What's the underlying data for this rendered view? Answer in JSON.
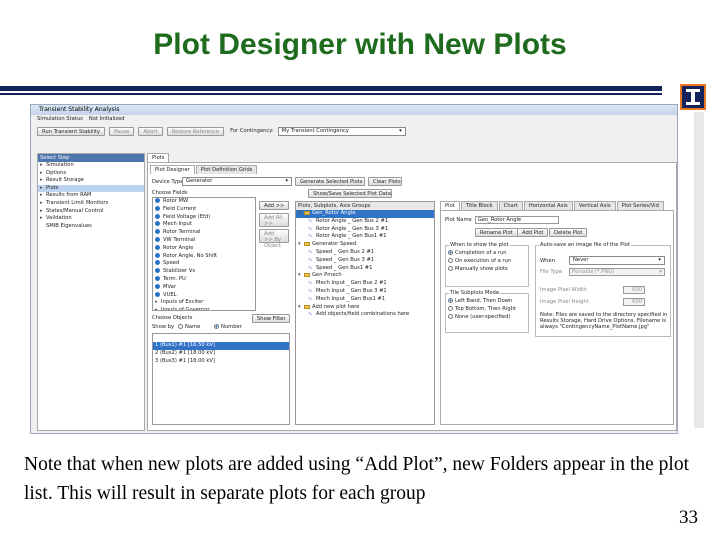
{
  "slide": {
    "title": "Plot Designer with New Plots",
    "caption": "Note that when new plots are added using “Add Plot”, new Folders appear in the plot list.  This will result in separate plots for each group",
    "page_number": "33"
  },
  "app": {
    "window_title": "Transient Stability Analysis",
    "status_label": "Simulation Status",
    "status_value": "Not Initialized",
    "toolbar": {
      "run": "Run Transient Stability",
      "pause": "Pause",
      "abort": "Abort",
      "restore": "Restore Reference",
      "contingency_label": "For Contingency:",
      "contingency_value": "My Transient Contingency"
    },
    "select_step": "Select Step",
    "steps": [
      {
        "label": "Simulation",
        "expandable": true
      },
      {
        "label": "Options",
        "expandable": true
      },
      {
        "label": "Result Storage",
        "expandable": true
      },
      {
        "label": "Plots",
        "expandable": true,
        "selected": true
      },
      {
        "label": "Results from RAM",
        "expandable": true
      },
      {
        "label": "Transient Limit Monitors",
        "expandable": true
      },
      {
        "label": "States/Manual Control",
        "expandable": true
      },
      {
        "label": "Validation",
        "expandable": true
      },
      {
        "label": "SMIB Eigenvalues",
        "expandable": false
      }
    ],
    "main_tabs": [
      "Plot Designer",
      "Plot Definition Grids"
    ],
    "main_tab_top": "Plots",
    "device_type_label": "Device Type",
    "device_type_value": "Generator",
    "choose_fields_label": "Choose Fields",
    "fields": [
      "Rotor MW",
      "Field Current",
      "Field Voltage (Efd)",
      "Mech Input",
      "Rotor Terminal",
      "VW Terminal",
      "Rotor Angle",
      "Rotor Angle, No Shift",
      "Speed",
      "Stabilizer Vs",
      "Term. PU",
      "MVar",
      "VUEL",
      "Inputs of Exciter",
      "Inputs of Governor"
    ],
    "add_btn": "Add >>",
    "add_all_btn": "Add All >>",
    "add_by_obj_btn": "Add >> By Object",
    "choose_objects_label": "Choose Objects",
    "show_by_label": "Show by",
    "show_by_options": [
      "Name",
      "Number"
    ],
    "show_filter_btn": "Show Filter",
    "objects": [
      "1 (Bus1) #1 [16.50 kV]",
      "2 (Bus2) #1 [18.00 kV]",
      "3 (Bus3) #1 [18.00 kV]"
    ],
    "generate_btn": "Generate Selected Plots",
    "clear_plots_btn": "Clear Plots",
    "show_save_btn": "Show/Save Selected Plot Data",
    "plots_header": "Plots, Subplots, Axis Groups",
    "plot_tree": [
      {
        "kind": "folder",
        "label": "Gen_Rotor Angle",
        "level": 0,
        "selected": true
      },
      {
        "kind": "item",
        "label": "Rotor Angle _ Gen Bus 2 #1",
        "level": 1
      },
      {
        "kind": "item",
        "label": "Rotor Angle _ Gen Bus 3 #1",
        "level": 1
      },
      {
        "kind": "item",
        "label": "Rotor Angle _ Gen Bus1 #1",
        "level": 1
      },
      {
        "kind": "folder",
        "label": "Generator Speed",
        "level": 0
      },
      {
        "kind": "item",
        "label": "Speed _ Gen Bus 2 #1",
        "level": 1
      },
      {
        "kind": "item",
        "label": "Speed _ Gen Bus 3 #1",
        "level": 1
      },
      {
        "kind": "item",
        "label": "Speed _ Gen Bus1 #1",
        "level": 1
      },
      {
        "kind": "folder",
        "label": "Gen Pmech",
        "level": 0
      },
      {
        "kind": "item",
        "label": "Mech Input _ Gen Bus 2 #1",
        "level": 1
      },
      {
        "kind": "item",
        "label": "Mech Input _ Gen Bus 3 #1",
        "level": 1
      },
      {
        "kind": "item",
        "label": "Mech Input _ Gen Bus1 #1",
        "level": 1
      },
      {
        "kind": "folder",
        "label": "Add new plot here",
        "level": 0
      },
      {
        "kind": "item",
        "label": "Add objects/field combinations here",
        "level": 1
      }
    ],
    "right_tabs": [
      "Plot",
      "Title Block",
      "Chart",
      "Horizontal Axis",
      "Vertical Axis",
      "Plot Series/Vid"
    ],
    "plot_name_label": "Plot Name",
    "plot_name_value": "Gen_Rotor Angle",
    "rename_btn": "Rename Plot",
    "add_plot_btn": "Add Plot",
    "delete_plot_btn": "Delete Plot",
    "when_show_label": "When to show the plot",
    "when_show_options": [
      "Completion of a run",
      "On execution of a run",
      "Manually show plots"
    ],
    "subplots_label": "Tile Subplots Mode",
    "subplots_options": [
      "Left Band, Then Down",
      "Top Bottom, Then Right",
      "None (user-specified)"
    ],
    "autosave_label": "Auto-save an image file of the Plot",
    "when_label": "When",
    "when_value": "Never",
    "filetype_label": "File Type",
    "filetype_value": "Portable (*.PNG)",
    "image_width_label": "Image Pixel Width",
    "image_width_value": "600",
    "image_height_label": "Image Pixel Height",
    "image_height_value": "600",
    "note": "Note: Files are saved to the directory specified in Results Storage, Hard Drive Options. Filename is always \"ContingencyName_PlotName.jpg\""
  }
}
